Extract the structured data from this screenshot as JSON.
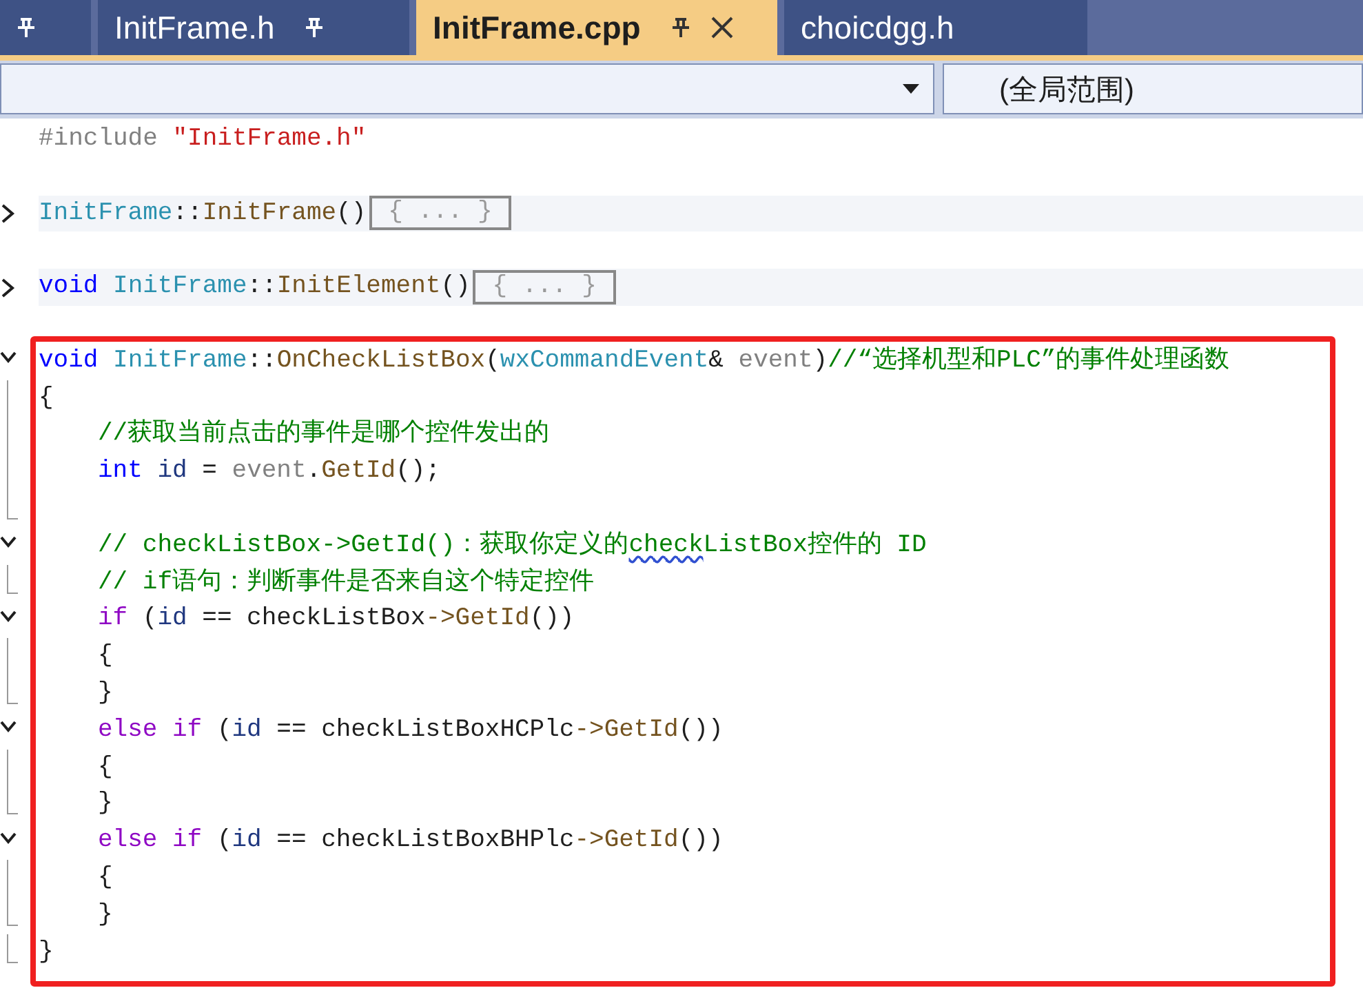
{
  "tabs": [
    {
      "pinned": true,
      "selected": false
    },
    {
      "label": "InitFrame.h",
      "pinned": true,
      "selected": false
    },
    {
      "label": "InitFrame.cpp",
      "pinned": true,
      "selected": true,
      "closable": true
    },
    {
      "label": "choicdgg.h",
      "pinned": false,
      "selected": false
    }
  ],
  "navigation_bar": {
    "member_dropdown": {
      "value": "(全局范围)"
    }
  },
  "code_lines": [
    {
      "kind": "code",
      "tokens": [
        {
          "t": "#include",
          "kind": "pp"
        },
        {
          "t": "\"InitFrame.h\"",
          "kind": "str"
        }
      ]
    },
    {
      "kind": "blank"
    },
    {
      "kind": "folded",
      "gutter": {
        "kind": "collapsed"
      },
      "tokens": [
        {
          "t": "InitFrame",
          "kind": "type"
        },
        {
          "t": "::",
          "kind": "plain"
        },
        {
          "t": "InitFrame",
          "kind": "fn"
        },
        {
          "t": "()",
          "kind": "plain"
        }
      ],
      "ellipsis": "{ ... }"
    },
    {
      "kind": "blank"
    },
    {
      "kind": "folded",
      "gutter": {
        "kind": "collapsed"
      },
      "tokens": [
        {
          "t": "void",
          "kind": "kw"
        },
        {
          "t": "InitFrame",
          "kind": "type"
        },
        {
          "t": "::",
          "kind": "plain"
        },
        {
          "t": "InitElement",
          "kind": "fn"
        },
        {
          "t": "()",
          "kind": "plain"
        }
      ],
      "ellipsis": "{ ... }"
    },
    {
      "kind": "blank"
    },
    {
      "kind": "code",
      "gutter": {
        "kind": "expanded"
      },
      "boxed": true,
      "tokens": [
        {
          "t": "void",
          "kind": "kw"
        },
        {
          "t": "InitFrame",
          "kind": "type"
        },
        {
          "t": "::",
          "kind": "plain"
        },
        {
          "t": "OnCheckListBox",
          "kind": "fn"
        },
        {
          "t": "(",
          "kind": "plain"
        },
        {
          "t": "wxCommandEvent",
          "kind": "type"
        },
        {
          "t": "&",
          "kind": "plain"
        },
        {
          "t": "event",
          "kind": "param"
        },
        {
          "t": ")",
          "kind": "plain"
        },
        {
          "t": "//“选择机型和PLC”的事件处理函数",
          "kind": "cmt"
        }
      ]
    },
    {
      "kind": "code",
      "gutter": {
        "kind": "inner"
      },
      "boxed": true,
      "tokens": [
        {
          "t": "{",
          "kind": "plain"
        }
      ]
    },
    {
      "kind": "code",
      "gutter": {
        "kind": "inner"
      },
      "boxed": true,
      "indent": true,
      "tokens": [
        {
          "t": "//获取当前点击的事件是哪个控件发出的",
          "kind": "cmt"
        }
      ]
    },
    {
      "kind": "code",
      "gutter": {
        "kind": "inner"
      },
      "boxed": true,
      "indent": true,
      "tokens": [
        {
          "t": "int",
          "kind": "kw"
        },
        {
          "t": "id",
          "kind": "var"
        },
        {
          "t": "=",
          "kind": "plain"
        },
        {
          "t": "event",
          "kind": "param"
        },
        {
          "t": ".",
          "kind": "plain"
        },
        {
          "t": "GetId",
          "kind": "fn"
        },
        {
          "t": "();",
          "kind": "plain"
        }
      ]
    },
    {
      "kind": "blank",
      "gutter": {
        "kind": "end"
      }
    },
    {
      "kind": "code",
      "gutter": {
        "kind": "expanded"
      },
      "boxed": true,
      "indent": true,
      "tokens": [
        {
          "t": "// checkListBox->GetId()：获取你定义的",
          "kind": "cmt"
        },
        {
          "t": "check",
          "kind": "cmt",
          "squiggle": true
        },
        {
          "t": "ListBox控件的 ID",
          "kind": "cmt"
        }
      ]
    },
    {
      "kind": "code",
      "gutter": {
        "kind": "end"
      },
      "boxed": true,
      "indent": true,
      "tokens": [
        {
          "t": "// if语句：判断事件是否来自这个特定控件",
          "kind": "cmt"
        }
      ]
    },
    {
      "kind": "code",
      "gutter": {
        "kind": "expanded"
      },
      "boxed": true,
      "indent": true,
      "tokens": [
        {
          "t": "if",
          "kind": "ctl"
        },
        {
          "t": "(",
          "kind": "plain"
        },
        {
          "t": "id",
          "kind": "var"
        },
        {
          "t": "== checkListBox",
          "kind": "plain"
        },
        {
          "t": "->GetId",
          "kind": "fn"
        },
        {
          "t": "())",
          "kind": "plain"
        }
      ]
    },
    {
      "kind": "code",
      "gutter": {
        "kind": "inner"
      },
      "boxed": true,
      "indent": true,
      "tokens": [
        {
          "t": "{",
          "kind": "plain"
        }
      ]
    },
    {
      "kind": "code",
      "gutter": {
        "kind": "end"
      },
      "boxed": true,
      "indent": true,
      "tokens": [
        {
          "t": "}",
          "kind": "plain"
        }
      ]
    },
    {
      "kind": "code",
      "gutter": {
        "kind": "expanded"
      },
      "boxed": true,
      "indent": true,
      "tokens": [
        {
          "t": "else if",
          "kind": "ctl"
        },
        {
          "t": "(",
          "kind": "plain"
        },
        {
          "t": "id",
          "kind": "var"
        },
        {
          "t": "== checkListBoxHCPlc",
          "kind": "plain"
        },
        {
          "t": "->GetId",
          "kind": "fn"
        },
        {
          "t": "())",
          "kind": "plain"
        }
      ]
    },
    {
      "kind": "code",
      "gutter": {
        "kind": "inner"
      },
      "boxed": true,
      "indent": true,
      "tokens": [
        {
          "t": "{",
          "kind": "plain"
        }
      ]
    },
    {
      "kind": "code",
      "gutter": {
        "kind": "end"
      },
      "boxed": true,
      "indent": true,
      "tokens": [
        {
          "t": "}",
          "kind": "plain"
        }
      ]
    },
    {
      "kind": "code",
      "gutter": {
        "kind": "expanded"
      },
      "boxed": true,
      "indent": true,
      "tokens": [
        {
          "t": "else if",
          "kind": "ctl"
        },
        {
          "t": "(",
          "kind": "plain"
        },
        {
          "t": "id",
          "kind": "var"
        },
        {
          "t": "== checkListBoxBHPlc",
          "kind": "plain"
        },
        {
          "t": "->GetId",
          "kind": "fn"
        },
        {
          "t": "())",
          "kind": "plain"
        }
      ]
    },
    {
      "kind": "code",
      "gutter": {
        "kind": "inner"
      },
      "boxed": true,
      "indent": true,
      "tokens": [
        {
          "t": "{",
          "kind": "plain"
        }
      ]
    },
    {
      "kind": "code",
      "gutter": {
        "kind": "end"
      },
      "boxed": true,
      "indent": true,
      "tokens": [
        {
          "t": "}",
          "kind": "plain"
        }
      ]
    },
    {
      "kind": "code",
      "gutter": {
        "kind": "end"
      },
      "boxed": true,
      "tokens": [
        {
          "t": "}",
          "kind": "plain"
        }
      ]
    }
  ]
}
